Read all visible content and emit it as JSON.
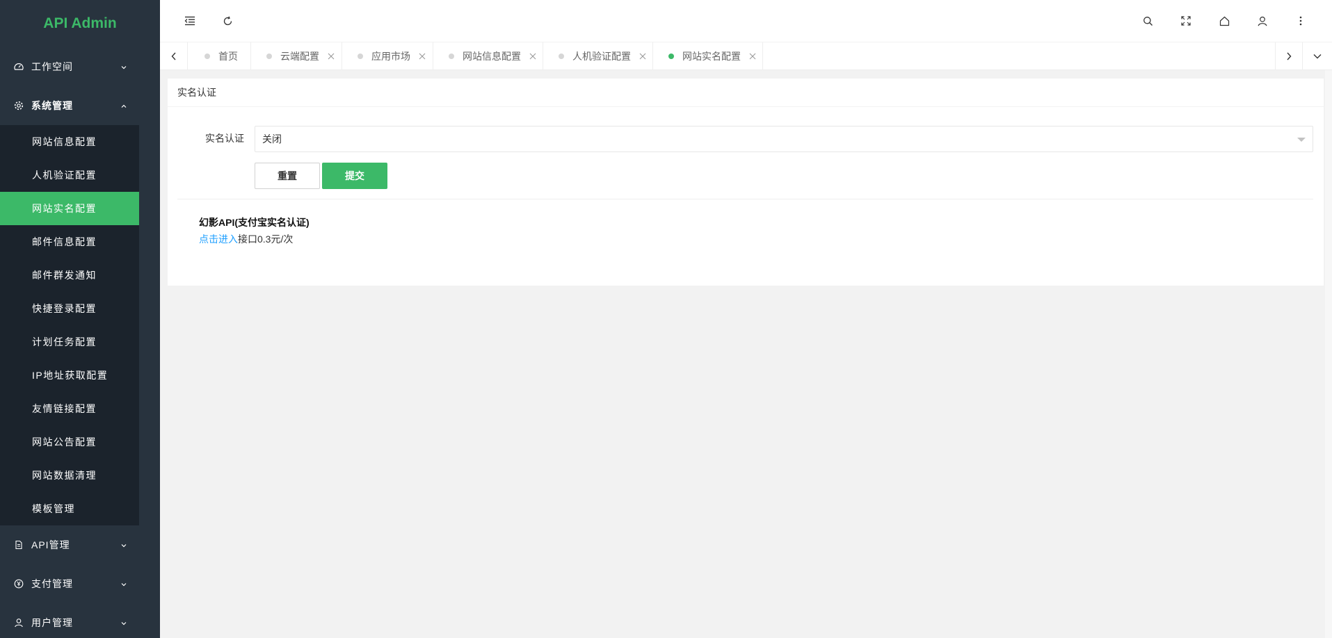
{
  "app": {
    "logo": "API Admin"
  },
  "sidebar": {
    "groups": [
      {
        "label": "工作空间",
        "icon": "dashboard-icon",
        "expanded": false
      },
      {
        "label": "系统管理",
        "icon": "gear-icon",
        "expanded": true
      },
      {
        "label": "API管理",
        "icon": "document-icon",
        "expanded": false
      },
      {
        "label": "支付管理",
        "icon": "yen-icon",
        "expanded": false
      },
      {
        "label": "用户管理",
        "icon": "user-icon",
        "expanded": false
      }
    ],
    "system_items": [
      {
        "label": "网站信息配置"
      },
      {
        "label": "人机验证配置"
      },
      {
        "label": "网站实名配置",
        "active": true
      },
      {
        "label": "邮件信息配置"
      },
      {
        "label": "邮件群发通知"
      },
      {
        "label": "快捷登录配置"
      },
      {
        "label": "计划任务配置"
      },
      {
        "label": "IP地址获取配置"
      },
      {
        "label": "友情链接配置"
      },
      {
        "label": "网站公告配置"
      },
      {
        "label": "网站数据清理"
      },
      {
        "label": "模板管理"
      }
    ]
  },
  "tabs": [
    {
      "label": "首页",
      "closable": false
    },
    {
      "label": "云端配置",
      "closable": true
    },
    {
      "label": "应用市场",
      "closable": true
    },
    {
      "label": "网站信息配置",
      "closable": true
    },
    {
      "label": "人机验证配置",
      "closable": true
    },
    {
      "label": "网站实名配置",
      "closable": true,
      "active": true
    }
  ],
  "main": {
    "card_title": "实名认证",
    "form": {
      "field_label": "实名认证",
      "select_value": "关闭",
      "reset_label": "重置",
      "submit_label": "提交"
    },
    "api_info": {
      "title": "幻影API(支付宝实名认证)",
      "link_text": "点击进入",
      "price_text": "接口0.3元/次"
    }
  },
  "colors": {
    "accent": "#3cb968",
    "sidebar_bg": "#28333e",
    "submenu_bg": "#1b232c",
    "link": "#1e9fff"
  }
}
